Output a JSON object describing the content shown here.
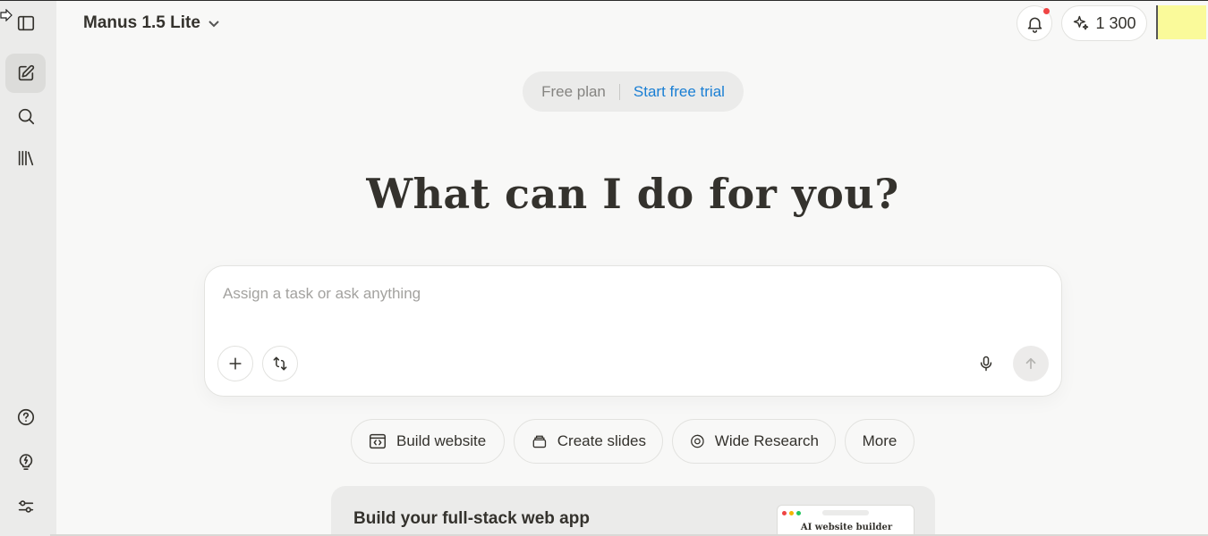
{
  "header": {
    "model_label": "Manus 1.5 Lite",
    "credits": "1 300"
  },
  "plan": {
    "free_label": "Free plan",
    "trial_label": "Start free trial"
  },
  "hero": {
    "title": "What can I do for you?"
  },
  "task_box": {
    "placeholder": "Assign a task or ask anything"
  },
  "quick_actions": [
    {
      "label": "Build website",
      "icon": "code-window-icon"
    },
    {
      "label": "Create slides",
      "icon": "slides-stack-icon"
    },
    {
      "label": "Wide Research",
      "icon": "research-orbit-icon"
    },
    {
      "label": "More"
    }
  ],
  "promo": {
    "title": "Build your full-stack web app",
    "preview_label": "AI website builder"
  },
  "colors": {
    "accent_link": "#1a7fd4",
    "notification_dot": "#ef4444",
    "background": "#f8f8f7",
    "sidebar": "#ebebea"
  }
}
